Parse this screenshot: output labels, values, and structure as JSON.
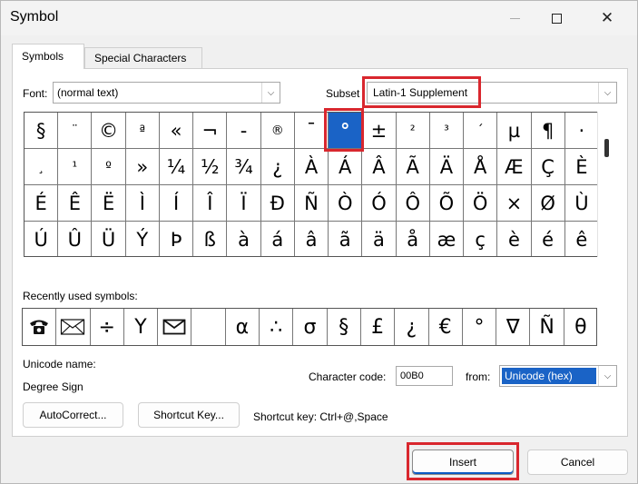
{
  "window": {
    "title": "Symbol",
    "min_icon": "minimize-icon",
    "max_icon": "maximize-icon",
    "close_icon": "close-icon",
    "close_glyph": "✕"
  },
  "tabs": [
    {
      "label": "Symbols",
      "active": true
    },
    {
      "label": "Special Characters",
      "active": false
    }
  ],
  "font": {
    "label": "Font:",
    "value": "(normal text)"
  },
  "subset": {
    "label": "Subset",
    "value": "Latin-1 Supplement"
  },
  "symbol_grid": {
    "rows": [
      [
        "§",
        "¨",
        "©",
        "ª",
        "«",
        "¬",
        "-",
        "®",
        "¯",
        "°",
        "±",
        "²",
        "³",
        "´",
        "µ",
        "¶",
        "·"
      ],
      [
        "¸",
        "¹",
        "º",
        "»",
        "¼",
        "½",
        "¾",
        "¿",
        "À",
        "Á",
        "Â",
        "Ã",
        "Ä",
        "Å",
        "Æ",
        "Ç",
        "È"
      ],
      [
        "É",
        "Ê",
        "Ë",
        "Ì",
        "Í",
        "Î",
        "Ï",
        "Ð",
        "Ñ",
        "Ò",
        "Ó",
        "Ô",
        "Õ",
        "Ö",
        "×",
        "Ø",
        "Ù"
      ],
      [
        "Ú",
        "Û",
        "Ü",
        "Ý",
        "Þ",
        "ß",
        "à",
        "á",
        "â",
        "ã",
        "ä",
        "å",
        "æ",
        "ç",
        "è",
        "é",
        "ê"
      ]
    ],
    "selected": "°"
  },
  "recent": {
    "label": "Recently used symbols:",
    "items": [
      "telephone-icon",
      "envelope-icon",
      "÷",
      "Y",
      "mail-icon",
      "",
      "α",
      "∴",
      "σ",
      "§",
      "£",
      "¿",
      "€",
      "°",
      "∇",
      "Ñ",
      "θ"
    ]
  },
  "unicode_name": {
    "label": "Unicode name:",
    "value": "Degree Sign"
  },
  "char_code": {
    "label": "Character code:",
    "value": "00B0"
  },
  "from": {
    "label": "from:",
    "value": "Unicode (hex)"
  },
  "buttons": {
    "autocorrect": "AutoCorrect...",
    "shortcut_key": "Shortcut Key...",
    "insert": "Insert",
    "cancel": "Cancel"
  },
  "shortcut_text": "Shortcut key: Ctrl+@,Space",
  "colors": {
    "highlight": "#d9272e",
    "selection": "#1a63c6"
  }
}
